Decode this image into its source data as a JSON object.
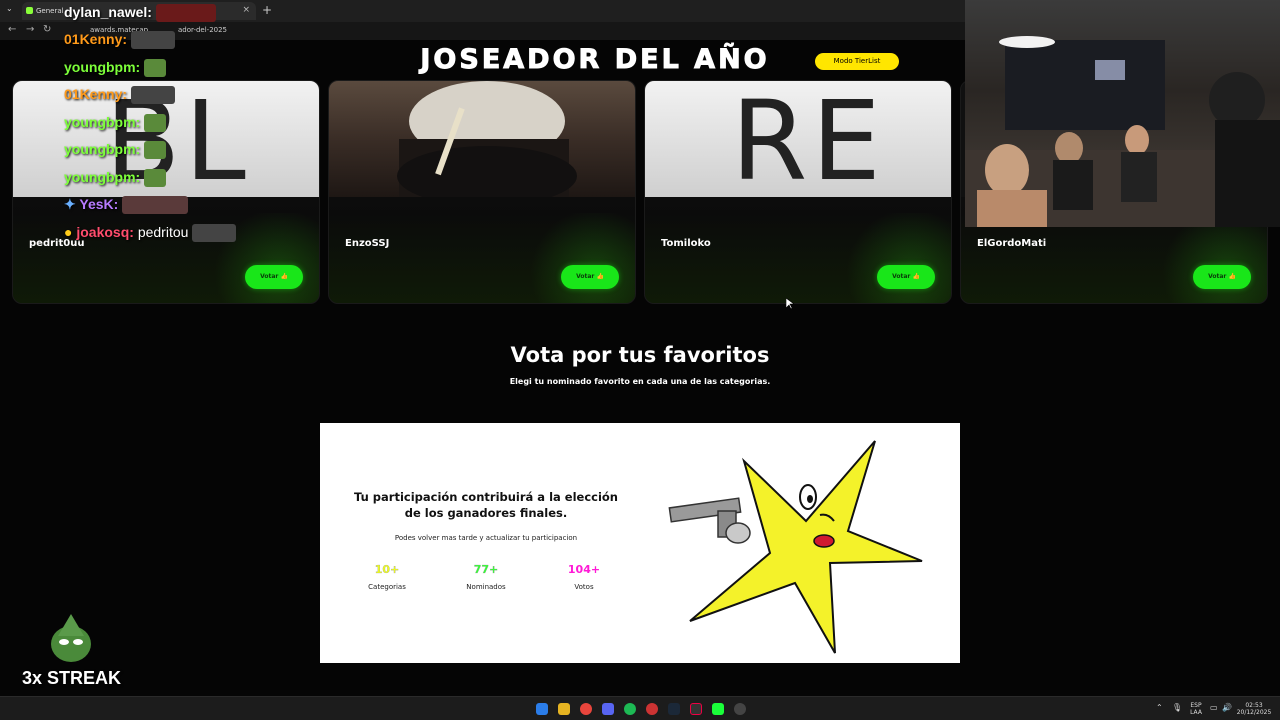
{
  "browser": {
    "tab_title": "General - ",
    "url": "awards.matecap",
    "url_tail": "ador-del-2025"
  },
  "page": {
    "title": "JOSEADOR DEL AÑO",
    "tierlist_button": "Modo TierList"
  },
  "cards": [
    {
      "name": "pedrit0uu",
      "image_text": "BL",
      "vote_label": "Votar 👍"
    },
    {
      "name": "EnzoSSJ",
      "image_text": "",
      "vote_label": "Votar 👍"
    },
    {
      "name": "Tomiloko",
      "image_text": "RE",
      "vote_label": "Votar 👍"
    },
    {
      "name": "ElGordoMati",
      "image_text": "",
      "vote_label": "Votar 👍"
    }
  ],
  "section": {
    "title": "Vota por tus favoritos",
    "subtitle": "Elegi tu nominado favorito en cada una de las categorias."
  },
  "panel": {
    "heading": "Tu participación contribuirá a la elección de los ganadores finales.",
    "description": "Podes volver mas tarde y actualizar tu participacion",
    "stats": [
      {
        "value": "10+",
        "label": "Categorias",
        "color": "#f0ff1a"
      },
      {
        "value": "77+",
        "label": "Nominados",
        "color": "#33ff33"
      },
      {
        "value": "104+",
        "label": "Votos",
        "color": "#ff1ad6"
      }
    ]
  },
  "chat": [
    {
      "user": "dylan_nawel:",
      "color": "#ffffff",
      "text": ""
    },
    {
      "user": "01Kenny:",
      "color": "#ff9a1a",
      "text": ""
    },
    {
      "user": "youngbpm:",
      "color": "#7dff3a",
      "text": ""
    },
    {
      "user": "01Kenny:",
      "color": "#ff9a1a",
      "text": ""
    },
    {
      "user": "youngbpm:",
      "color": "#7dff3a",
      "text": ""
    },
    {
      "user": "youngbpm:",
      "color": "#7dff3a",
      "text": ""
    },
    {
      "user": "youngbpm:",
      "color": "#7dff3a",
      "text": ""
    },
    {
      "user": "YesK:",
      "color": "#b77bff",
      "text": ""
    },
    {
      "user": "joakosq:",
      "color": "#ff4d6d",
      "text": "pedritou"
    }
  ],
  "streak": "3x STREAK",
  "taskbar": {
    "lang_top": "ESP",
    "lang_bottom": "LAA",
    "time": "02:53",
    "date": "20/12/2025"
  }
}
